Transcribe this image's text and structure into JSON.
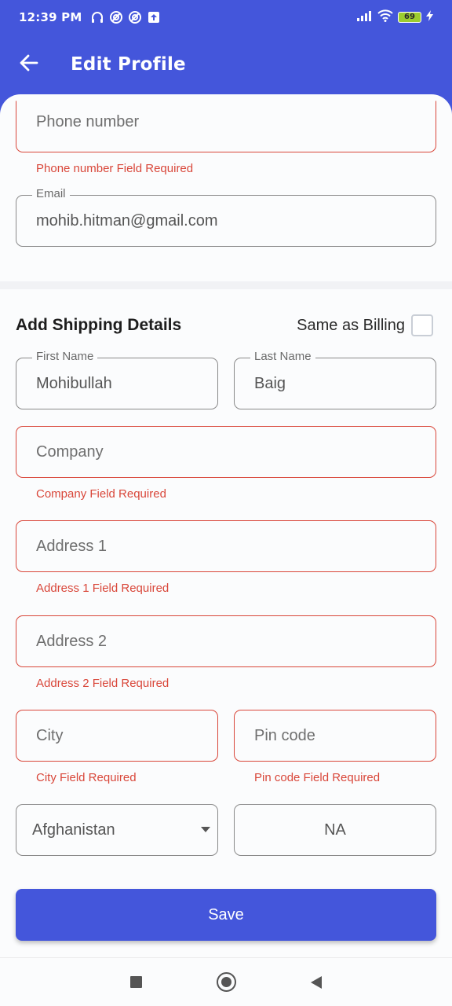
{
  "status_bar": {
    "time": "12:39 PM",
    "battery": "69",
    "icons": [
      "headset-icon",
      "vpn-icon",
      "vpn-icon",
      "upload-icon",
      "signal-icon",
      "wifi-icon",
      "battery-icon",
      "charging-icon"
    ]
  },
  "app_bar": {
    "title": "Edit Profile",
    "back_icon": "arrow-left-icon"
  },
  "billing": {
    "phone": {
      "placeholder": "Phone number",
      "error": "Phone number Field Required"
    },
    "email": {
      "label": "Email",
      "value": "mohib.hitman@gmail.com"
    }
  },
  "shipping": {
    "title": "Add Shipping Details",
    "same_as_billing": {
      "label": "Same as Billing",
      "checked": false
    },
    "first_name": {
      "label": "First Name",
      "value": "Mohibullah"
    },
    "last_name": {
      "label": "Last Name",
      "value": "Baig"
    },
    "company": {
      "placeholder": "Company",
      "error": "Company Field Required"
    },
    "address1": {
      "placeholder": "Address 1",
      "error": "Address 1 Field Required"
    },
    "address2": {
      "placeholder": "Address 2",
      "error": "Address 2 Field Required"
    },
    "city": {
      "placeholder": "City",
      "error": "City Field Required"
    },
    "pincode": {
      "placeholder": "Pin code",
      "error": "Pin code Field Required"
    },
    "country": {
      "value": "Afghanistan"
    },
    "state": {
      "value": "NA"
    }
  },
  "save_label": "Save",
  "colors": {
    "primary": "#4456db",
    "error": "#d9473a",
    "border": "#8a8a8a",
    "background": "#fbfcfd"
  },
  "nav_bar": {
    "icons": [
      "recents-square-icon",
      "home-circle-icon",
      "back-triangle-icon"
    ]
  }
}
